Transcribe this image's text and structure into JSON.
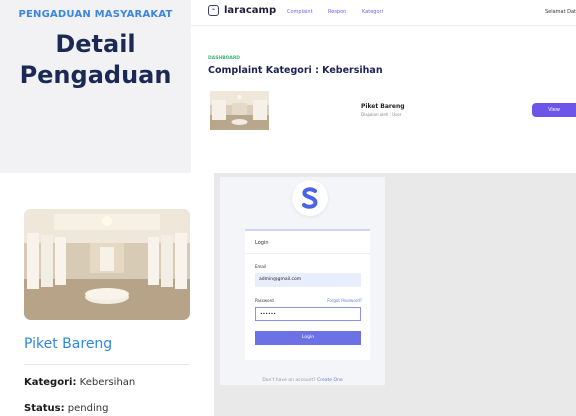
{
  "title_card": {
    "kicker": "PENGADUAN MASYARAKAT",
    "line1": "Detail",
    "line2": "Pengaduan"
  },
  "dashboard": {
    "logo_text": "laracamp",
    "logo_icon": "logo-icon",
    "nav": [
      "Complaint",
      "Respon",
      "Kategori"
    ],
    "greeting": "Selamat Dat",
    "breadcrumb": "DASHBOARD",
    "heading": "Complaint Kategori : Kebersihan",
    "row": {
      "title": "Piket Bareng",
      "subtitle": "Diajukan oleh : User",
      "view_label": "View"
    },
    "colors": {
      "accent": "#6e55ea",
      "breadcrumb": "#3ab37a",
      "heading": "#1c2255"
    }
  },
  "detail": {
    "name": "Piket Bareng",
    "kategori_label": "Kategori:",
    "kategori_value": "Kebersihan",
    "status_label": "Status:",
    "status_value": "pending",
    "colors": {
      "name": "#2f86e2"
    }
  },
  "login": {
    "title": "Login",
    "email_label": "Email",
    "email_value": "admin@gmail.com",
    "password_label": "Password",
    "forgot_label": "Forgot Password?",
    "password_value": "••••••",
    "button_label": "Login",
    "footer_text": "Don't have an account?",
    "footer_link": "Create One",
    "colors": {
      "button": "#6c72e6",
      "logo": "#4b63e8"
    }
  }
}
